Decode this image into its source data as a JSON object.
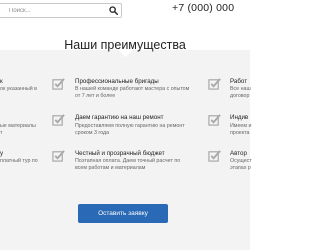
{
  "header": {
    "search_placeholder": "Поиск...",
    "phone": "+7 (000) 000"
  },
  "section": {
    "title": "Наши преимущества",
    "button_label": "Оставить заявку"
  },
  "features": {
    "left": [
      {
        "title": "к",
        "desc1": "ок указанный в",
        "desc2": ""
      },
      {
        "title": "",
        "desc1": "ые материалы",
        "desc2": "т"
      },
      {
        "title": "у",
        "desc1": "платный тур по",
        "desc2": ""
      }
    ],
    "middle": [
      {
        "title": "Профессиональные бригады",
        "desc1": "В нашей команде работают мастера с опытом",
        "desc2": "от 7 лет и более"
      },
      {
        "title": "Даем гарантию на наш ремонт",
        "desc1": "Предоставляем полную гарантию на ремонт",
        "desc2": "сроком 3 года"
      },
      {
        "title": "Честный и прозрачный бюджет",
        "desc1": "Поэтапная оплата. Даем точный расчет по",
        "desc2": "всем работам и материалам"
      }
    ],
    "right": [
      {
        "title": "Работ",
        "desc1": "Все наш",
        "desc2": "договор"
      },
      {
        "title": "Индив",
        "desc1": "Имеем и",
        "desc2": "проекта"
      },
      {
        "title": "Автор",
        "desc1": "Осущест",
        "desc2": "этапах р"
      }
    ]
  },
  "colors": {
    "accent": "#2a69b5",
    "section_bg": "#f3f3f3",
    "check_icon": "#a9a9a9"
  }
}
